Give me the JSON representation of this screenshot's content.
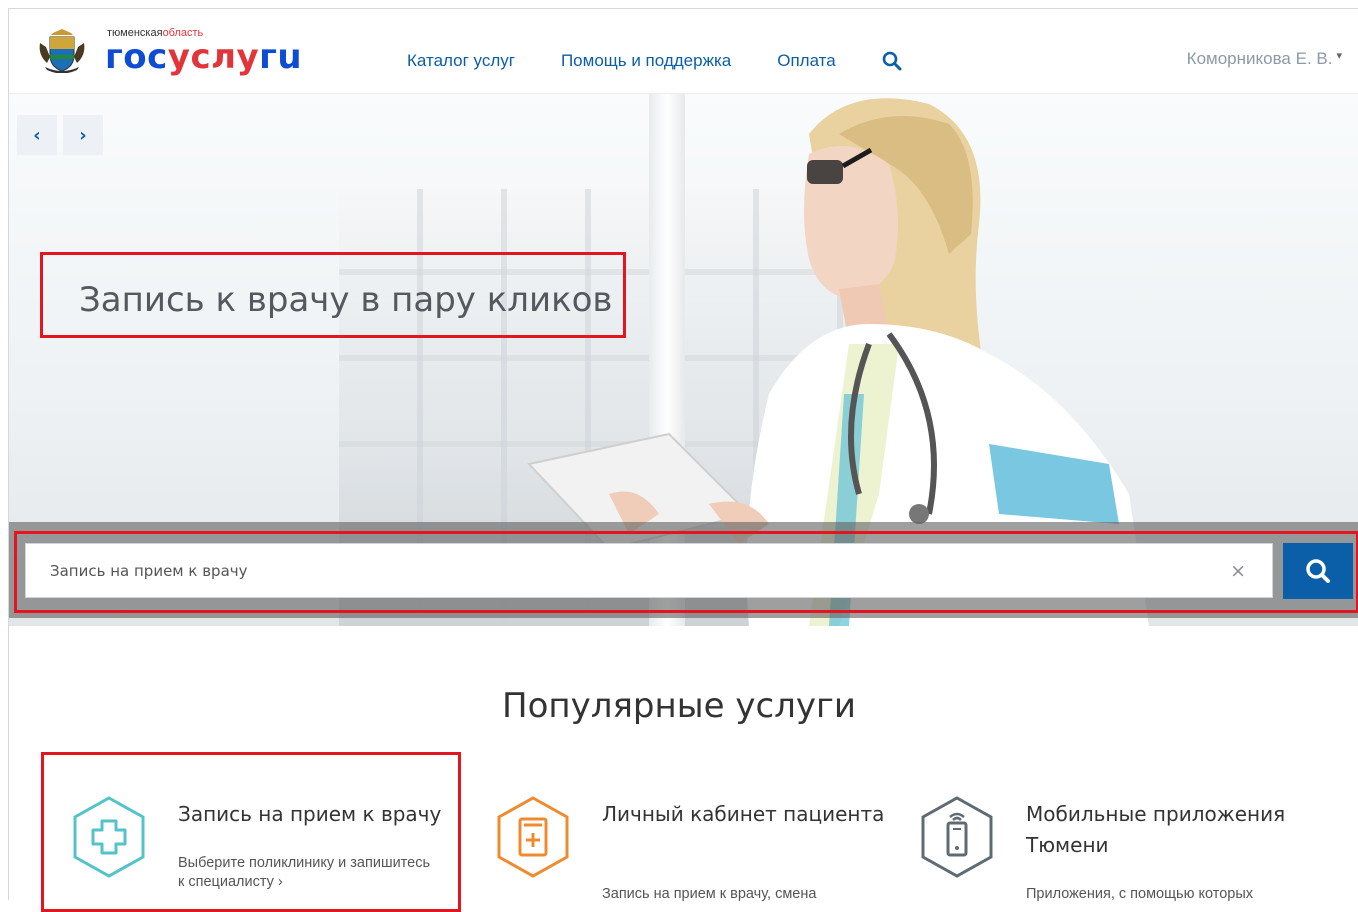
{
  "header": {
    "region_prefix": "тюменская",
    "region_accent": "область",
    "brand_part1": "гос",
    "brand_part2": "услу",
    "brand_part3": "гu",
    "nav": [
      "Каталог услуг",
      "Помощь и поддержка",
      "Оплата"
    ],
    "user_name": "Коморникова  Е. В.",
    "user_caret": "▾"
  },
  "hero": {
    "prev_arrow": "‹",
    "next_arrow": "›",
    "title": "Запись к врачу в пару кликов"
  },
  "search": {
    "value": "Запись на прием к врачу",
    "clear_symbol": "×"
  },
  "popular": {
    "title": "Популярные услуги",
    "services": [
      {
        "title": "Запись на прием к врачу",
        "desc": "Выберите поликлинику и запишитесь к специалисту ›",
        "icon": "medical-cross-icon"
      },
      {
        "title": "Личный кабинет пациента",
        "desc": "Запись на прием к врачу, смена",
        "icon": "medical-card-icon"
      },
      {
        "title": "Мобильные приложения Тюмени",
        "desc": "Приложения, с помощью которых",
        "icon": "mobile-phone-icon"
      }
    ]
  },
  "colors": {
    "brand_blue": "#0d4cd3",
    "brand_red": "#e2353a",
    "link_blue": "#0b5ea8",
    "highlight_red": "#e3151e",
    "teal": "#53c3c9",
    "orange": "#ef8b2f",
    "gray_icon": "#5f6b73"
  }
}
